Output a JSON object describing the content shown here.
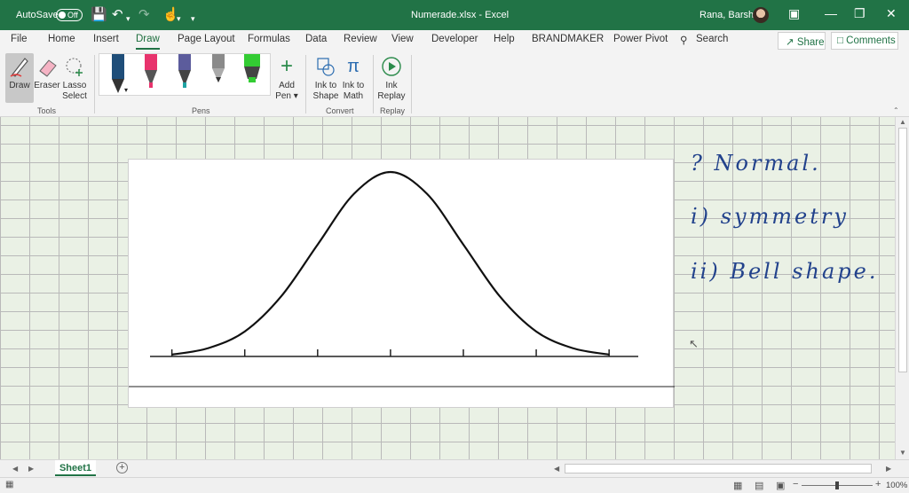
{
  "titlebar": {
    "autosave_label": "AutoSave",
    "autosave_state": "Off",
    "document_title": "Numerade.xlsx  -  Excel",
    "user_name": "Rana, Barsha"
  },
  "ribbon_tabs": [
    "File",
    "Home",
    "Insert",
    "Draw",
    "Page Layout",
    "Formulas",
    "Data",
    "Review",
    "View",
    "Developer",
    "Help",
    "BRANDMAKER",
    "Power Pivot"
  ],
  "active_tab": "Draw",
  "search": {
    "label": "Search"
  },
  "share_label": "Share",
  "comments_label": "Comments",
  "ribbon": {
    "tools": {
      "draw": "Draw",
      "eraser": "Eraser",
      "lasso_line1": "Lasso",
      "lasso_line2": "Select",
      "group": "Tools"
    },
    "pens_group": "Pens",
    "pen_colors": [
      "#1f4e79",
      "#e8336d",
      "#1fa3a3",
      "#7a7a7a",
      "#33cc33"
    ],
    "add_pen_line1": "Add",
    "add_pen_line2": "Pen",
    "convert": {
      "ink_shape_line1": "Ink to",
      "ink_shape_line2": "Shape",
      "ink_math_line1": "Ink to",
      "ink_math_line2": "Math",
      "group": "Convert"
    },
    "replay": {
      "line1": "Ink",
      "line2": "Replay",
      "group": "Replay"
    }
  },
  "chart_data": {
    "type": "line",
    "title": "",
    "xlabel": "",
    "ylabel": "",
    "x": [
      -3,
      -2.5,
      -2,
      -1.5,
      -1,
      -0.5,
      0,
      0.5,
      1,
      1.5,
      2,
      2.5,
      3
    ],
    "y": [
      0.004,
      0.018,
      0.054,
      0.13,
      0.242,
      0.352,
      0.399,
      0.352,
      0.242,
      0.13,
      0.054,
      0.018,
      0.004
    ],
    "ticks": [
      -3,
      -2,
      -1,
      0,
      1,
      2,
      3
    ],
    "xlim": [
      -3.3,
      3.4
    ],
    "grid": false,
    "legend": "none"
  },
  "notes": {
    "line1": "? Normal.",
    "line2": "i) symmetry",
    "line3": "ii) Bell shape."
  },
  "sheet_tab": "Sheet1",
  "zoom_level": "100%",
  "accent_color": "#217346"
}
